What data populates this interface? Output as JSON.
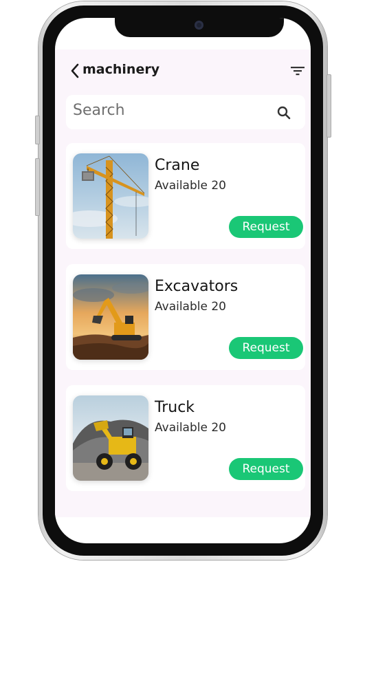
{
  "header": {
    "title": "machinery"
  },
  "search": {
    "placeholder": "Search"
  },
  "items": [
    {
      "name": "Crane",
      "availability": "Available 20",
      "action": "Request"
    },
    {
      "name": "Excavators",
      "availability": "Available 20",
      "action": "Request"
    },
    {
      "name": "Truck",
      "availability": "Available 20",
      "action": "Request"
    }
  ],
  "colors": {
    "accent": "#1ac776",
    "app_background": "#fbf5fb",
    "card_background": "#ffffff"
  },
  "icons": {
    "back": "chevron-left-icon",
    "filter": "filter-icon",
    "search": "search-icon"
  }
}
